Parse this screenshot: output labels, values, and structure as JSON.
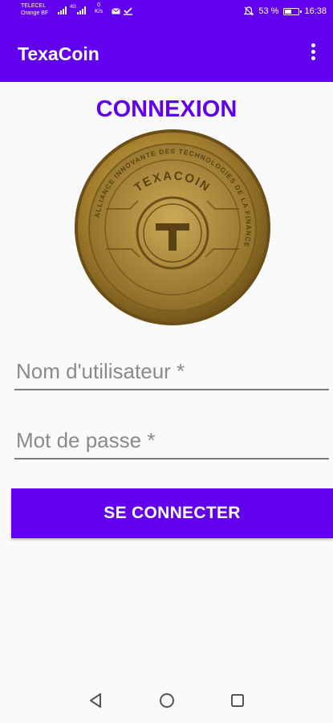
{
  "status_bar": {
    "carrier_1": "TELECEL",
    "carrier_2": "Orange BF",
    "signal_1": "4G",
    "speed_value": "0",
    "speed_unit": "K/s",
    "battery_text": "53 %",
    "battery_level": 0.53,
    "time": "16:38"
  },
  "app_bar": {
    "title": "TexaCoin",
    "menu_icon": "more-vert-icon"
  },
  "login": {
    "heading": "CONNEXION",
    "coin_text": "TEXACOIN",
    "coin_ring_text": "ALLIANCE INNOVANTE DES TECHNOLOGIES DE LA FINANCE",
    "username_placeholder": "Nom d'utilisateur *",
    "username_value": "",
    "password_placeholder": "Mot de passe *",
    "password_value": "",
    "submit_label": "SE CONNECTER"
  },
  "nav_bar": {
    "back_icon": "back-triangle-icon",
    "home_icon": "home-circle-icon",
    "recents_icon": "recents-square-icon"
  },
  "colors": {
    "primary": "#6200ee",
    "gold": "#b8963a"
  }
}
